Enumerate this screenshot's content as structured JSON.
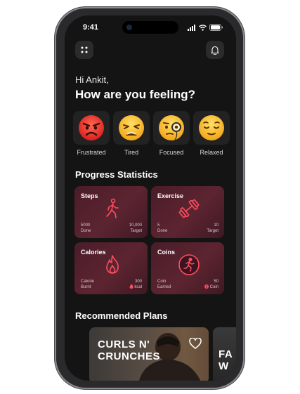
{
  "status_bar": {
    "time": "9:41"
  },
  "header": {
    "greeting": "Hi Ankit,",
    "question": "How are you feeling?"
  },
  "moods": [
    {
      "label": "Frustrated",
      "icon": "angry-face-emoji"
    },
    {
      "label": "Tired",
      "icon": "weary-face-emoji"
    },
    {
      "label": "Focused",
      "icon": "face-with-monocle-emoji"
    },
    {
      "label": "Relaxed",
      "icon": "relieved-face-emoji"
    }
  ],
  "progress": {
    "title": "Progress Statistics",
    "cards": [
      {
        "title": "Steps",
        "icon": "walking-person-icon",
        "left_value": "5000",
        "left_label": "Done",
        "right_value": "10,000",
        "right_label": "Target"
      },
      {
        "title": "Exercise",
        "icon": "dumbbell-icon",
        "left_value": "5",
        "left_label": "Done",
        "right_value": "10",
        "right_label": "Target"
      },
      {
        "title": "Calories",
        "icon": "flame-icon",
        "left_value": "Calorie",
        "left_label": "Burnt",
        "right_value": "300",
        "right_label": "kcal"
      },
      {
        "title": "Coins",
        "icon": "running-coin-icon",
        "left_value": "Coin",
        "left_label": "Earned",
        "right_value": "50",
        "right_label": "Coin"
      }
    ]
  },
  "recommended": {
    "title": "Recommended Plans",
    "plans": [
      {
        "line1": "CURLS N'",
        "line2": "CRUNCHES"
      },
      {
        "line1": "FA",
        "line2": "W"
      }
    ]
  },
  "colors": {
    "background": "#141414",
    "card": "#52212d",
    "accent": "#e8435a"
  }
}
